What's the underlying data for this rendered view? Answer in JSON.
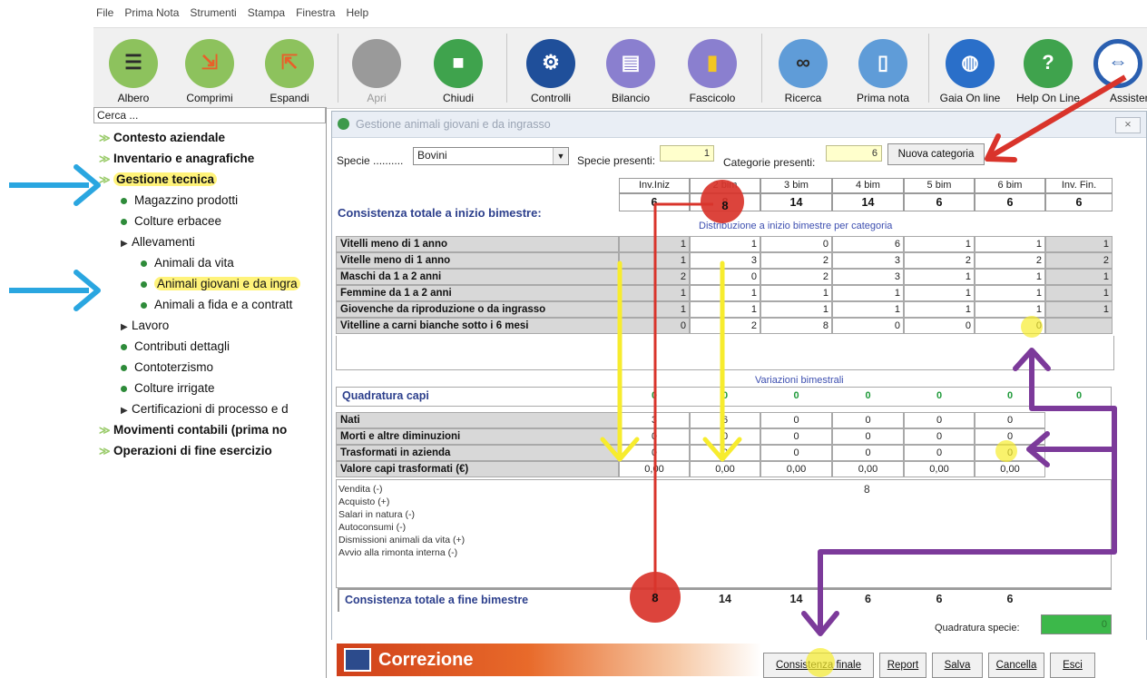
{
  "menu": [
    "File",
    "Prima Nota",
    "Strumenti",
    "Stampa",
    "Finestra",
    "Help"
  ],
  "toolbar": [
    {
      "label": "Albero",
      "icon": "tree-icon",
      "color": "#8dc25d"
    },
    {
      "label": "Comprimi",
      "icon": "compress-icon",
      "color": "#8dc25d"
    },
    {
      "label": "Espandi",
      "icon": "expand-icon",
      "color": "#8dc25d"
    },
    {
      "label": "Apri",
      "icon": "open-icon",
      "color": "#9a9a9a"
    },
    {
      "label": "Chiudi",
      "icon": "lock-icon",
      "color": "#3fa34d"
    },
    {
      "label": "Controlli",
      "icon": "gears-icon",
      "color": "#1f4f9a"
    },
    {
      "label": "Bilancio",
      "icon": "balance-icon",
      "color": "#8a7fcf"
    },
    {
      "label": "Fascicolo",
      "icon": "folder-icon",
      "color": "#8a7fcf"
    },
    {
      "label": "Ricerca",
      "icon": "binoculars-icon",
      "color": "#5f9cd8"
    },
    {
      "label": "Prima nota",
      "icon": "document-icon",
      "color": "#5f9cd8"
    },
    {
      "label": "Gaia On line",
      "icon": "globe-icon",
      "color": "#2a6fc9"
    },
    {
      "label": "Help On Line",
      "icon": "help-icon",
      "color": "#3fa34d"
    },
    {
      "label": "Assistenza",
      "icon": "remote-icon",
      "color": "#2a5fb0"
    }
  ],
  "search": {
    "placeholder": "Cerca ..."
  },
  "tree": {
    "contesto": "Contesto aziendale",
    "inventario": "Inventario e anagrafiche",
    "gestione": "Gestione tecnica",
    "magazzino": "Magazzino prodotti",
    "colture_erbacee": "Colture erbacee",
    "allevamenti": "Allevamenti",
    "animali_vita": "Animali da vita",
    "animali_giovani": "Animali giovani e da ingra",
    "animali_fida": "Animali a fida e a contratt",
    "lavoro": "Lavoro",
    "contributi": "Contributi dettagli",
    "contoterzismo": "Contoterzismo",
    "colture_irrigate": "Colture irrigate",
    "certificazioni": "Certificazioni di processo e d",
    "movimenti": "Movimenti contabili (prima no",
    "operazioni": "Operazioni di fine esercizio"
  },
  "window": {
    "title": "Gestione animali giovani e da ingrasso",
    "close": "⨯",
    "specie_label": "Specie ..........",
    "specie_value": "Bovini",
    "specie_presenti_label": "Specie presenti:",
    "specie_presenti": "1",
    "categorie_presenti_label": "Categorie presenti:",
    "categorie_presenti": "6",
    "nuova_categoria": "Nuova categoria"
  },
  "consistenza": {
    "label": "Consistenza totale a inizio bimestre:",
    "headers": [
      "Inv.Iniz",
      "2 bim",
      "3 bim",
      "4 bim",
      "5 bim",
      "6 bim",
      "Inv. Fin."
    ],
    "values": [
      "6",
      "8",
      "14",
      "14",
      "6",
      "6",
      "6"
    ],
    "distribuzione_label": "Distribuzione a inizio bimestre per categoria"
  },
  "categories": [
    {
      "name": "Vitelli meno di 1 anno",
      "values": [
        "1",
        "1",
        "0",
        "6",
        "1",
        "1",
        "1"
      ]
    },
    {
      "name": "Vitelle meno di 1 anno",
      "values": [
        "1",
        "3",
        "2",
        "3",
        "2",
        "2",
        "2"
      ]
    },
    {
      "name": "Maschi da 1 a 2 anni",
      "values": [
        "2",
        "0",
        "2",
        "3",
        "1",
        "1",
        "1"
      ]
    },
    {
      "name": "Femmine da 1 a 2 anni",
      "values": [
        "1",
        "1",
        "1",
        "1",
        "1",
        "1",
        "1"
      ]
    },
    {
      "name": "Giovenche da riproduzione o da ingrasso",
      "values": [
        "1",
        "1",
        "1",
        "1",
        "1",
        "1",
        "1"
      ]
    },
    {
      "name": "Vitelline a carni bianche sotto i 6 mesi",
      "values": [
        "0",
        "2",
        "8",
        "0",
        "0",
        "0",
        ""
      ]
    }
  ],
  "variazioni": {
    "label": "Variazioni bimestrali",
    "quadratura_label": "Quadratura capi",
    "quadratura_values": [
      "0",
      "0",
      "0",
      "0",
      "0",
      "0",
      "0"
    ],
    "rows": [
      {
        "name": "Nati",
        "values": [
          "3",
          "6",
          "0",
          "0",
          "0",
          "0"
        ]
      },
      {
        "name": "Morti e altre diminuzioni",
        "values": [
          "0",
          "0",
          "0",
          "0",
          "0",
          "0"
        ]
      },
      {
        "name": "Trasformati in azienda",
        "values": [
          "0",
          "0",
          "0",
          "0",
          "0",
          "0"
        ]
      },
      {
        "name": "Valore capi trasformati (€)",
        "values": [
          "0,00",
          "0,00",
          "0,00",
          "0,00",
          "0,00",
          "0,00"
        ]
      }
    ]
  },
  "movimenti": [
    {
      "label": "Vendita (-)",
      "value_col4": "8"
    },
    {
      "label": "Acquisto (+)"
    },
    {
      "label": "Salari in natura (-)"
    },
    {
      "label": "Autoconsumi (-)"
    },
    {
      "label": "Dismissioni animali da vita (+)"
    },
    {
      "label": "Avvio alla rimonta interna (-)"
    }
  ],
  "fine": {
    "label": "Consistenza totale a fine bimestre",
    "values": [
      "8",
      "14",
      "14",
      "6",
      "6",
      "6"
    ],
    "quadratura_specie_label": "Quadratura specie:",
    "quadratura_specie": "0"
  },
  "bottom": {
    "correzione": "Correzione",
    "consistenza_finale": "Consistenza finale",
    "report": "Report",
    "salva": "Salva",
    "cancella": "Cancella",
    "esci": "Esci"
  },
  "annotations": {
    "red_circle_top": "8",
    "red_circle_bottom": "8",
    "colors": {
      "blue_arrow": "#2aa6e0",
      "red": "#d9342b",
      "yellow": "#f7ec2e",
      "purple": "#7c3a9a"
    }
  }
}
